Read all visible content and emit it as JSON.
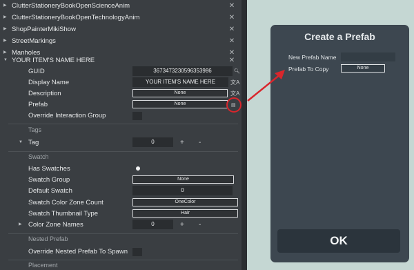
{
  "tree_items": [
    {
      "label": "ClutterStationeryBookOpenScienceAnim",
      "close": "✕"
    },
    {
      "label": "ClutterStationeryBookOpenTechnologyAnim",
      "close": "✕"
    },
    {
      "label": "ShopPainterMikiShow",
      "close": "✕"
    },
    {
      "label": "StreetMarkings",
      "close": "✕"
    },
    {
      "label": "Manholes",
      "close": "✕"
    },
    {
      "label": "YOUR ITEM'S NAME HERE",
      "close": "✕"
    }
  ],
  "fields": {
    "guid_label": "GUID",
    "guid_value": "3673473230596353986",
    "display_name_label": "Display Name",
    "display_name_value": "YOUR ITEM'S NAME HERE",
    "description_label": "Description",
    "description_value": "None",
    "prefab_label": "Prefab",
    "prefab_value": "None",
    "override_interaction_label": "Override Interaction Group"
  },
  "tags": {
    "header": "Tags",
    "tag_label": "Tag",
    "tag_count": "0",
    "plus": "+",
    "minus": "-"
  },
  "swatch": {
    "header": "Swatch",
    "has_swatches_label": "Has Swatches",
    "swatch_group_label": "Swatch Group",
    "swatch_group_value": "None",
    "default_swatch_label": "Default Swatch",
    "default_swatch_value": "0",
    "color_zone_count_label": "Swatch Color Zone Count",
    "color_zone_count_value": "OneColor",
    "thumbnail_type_label": "Swatch Thumbnail Type",
    "thumbnail_type_value": "Hair",
    "color_zone_names_label": "Color Zone Names",
    "color_zone_names_count": "0",
    "plus": "+",
    "minus": "-"
  },
  "nested_prefab": {
    "header": "Nested Prefab",
    "override_label": "Override Nested Prefab To Spawn"
  },
  "placement": {
    "header": "Placement"
  },
  "dialog": {
    "title": "Create a Prefab",
    "new_prefab_name_label": "New Prefab Name",
    "new_prefab_name_value": "",
    "prefab_to_copy_label": "Prefab To Copy",
    "prefab_to_copy_value": "None",
    "ok_label": "OK"
  },
  "colors": {
    "annotation_red": "#d9262c",
    "panel_bg": "#3a3e42",
    "dialog_bg": "#3d4750"
  },
  "icons": {
    "search": "search-icon",
    "translate": "translate-icon",
    "prefab_picker": "prefab-picker-icon",
    "expand": "triangle-expand-icon",
    "close": "close-icon"
  }
}
